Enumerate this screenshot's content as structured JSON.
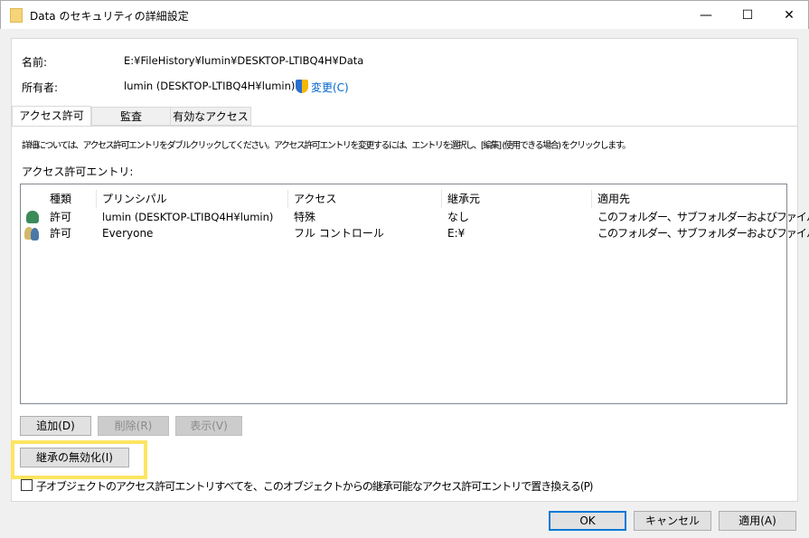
{
  "window": {
    "title": "Data のセキュリティの詳細設定",
    "minimize": "—",
    "maximize": "☐",
    "close": "✕"
  },
  "info": {
    "name_label": "名前:",
    "name_value": "E:¥FileHistory¥lumin¥DESKTOP-LTIBQ4H¥Data",
    "owner_label": "所有者:",
    "owner_value": "lumin (DESKTOP-LTIBQ4H¥lumin)",
    "change_link": "変更(C)"
  },
  "tabs": [
    {
      "label": "アクセス許可"
    },
    {
      "label": "監査"
    },
    {
      "label": "有効なアクセス"
    }
  ],
  "instructions": "詳細については、アクセス許可エントリをダブルクリックしてください。アクセス許可エントリを変更するには、エントリを選択し、[編集] (使用できる場合) をクリックします。",
  "entries_label": "アクセス許可エントリ:",
  "columns": [
    "種類",
    "プリンシパル",
    "アクセス",
    "継承元",
    "適用先"
  ],
  "rows": [
    {
      "type": "許可",
      "principal": "lumin (DESKTOP-LTIBQ4H¥lumin)",
      "access": "特殊",
      "inherited": "なし",
      "applies": "このフォルダー、サブフォルダーおよびファイル",
      "icon": "user-icon"
    },
    {
      "type": "許可",
      "principal": "Everyone",
      "access": "フル コントロール",
      "inherited": "E:¥",
      "applies": "このフォルダー、サブフォルダーおよびファイル",
      "icon": "group-icon"
    }
  ],
  "buttons": {
    "add": "追加(D)",
    "remove": "削除(R)",
    "view": "表示(V)",
    "disable_inheritance": "継承の無効化(I)",
    "ok": "OK",
    "cancel": "キャンセル",
    "apply": "適用(A)"
  },
  "replace_checkbox": {
    "label": "子オブジェクトのアクセス許可エントリすべてを、このオブジェクトからの継承可能なアクセス許可エントリで置き換える(P)",
    "checked": false
  },
  "colors": {
    "highlight": "#fde561",
    "link": "#0066cc"
  }
}
